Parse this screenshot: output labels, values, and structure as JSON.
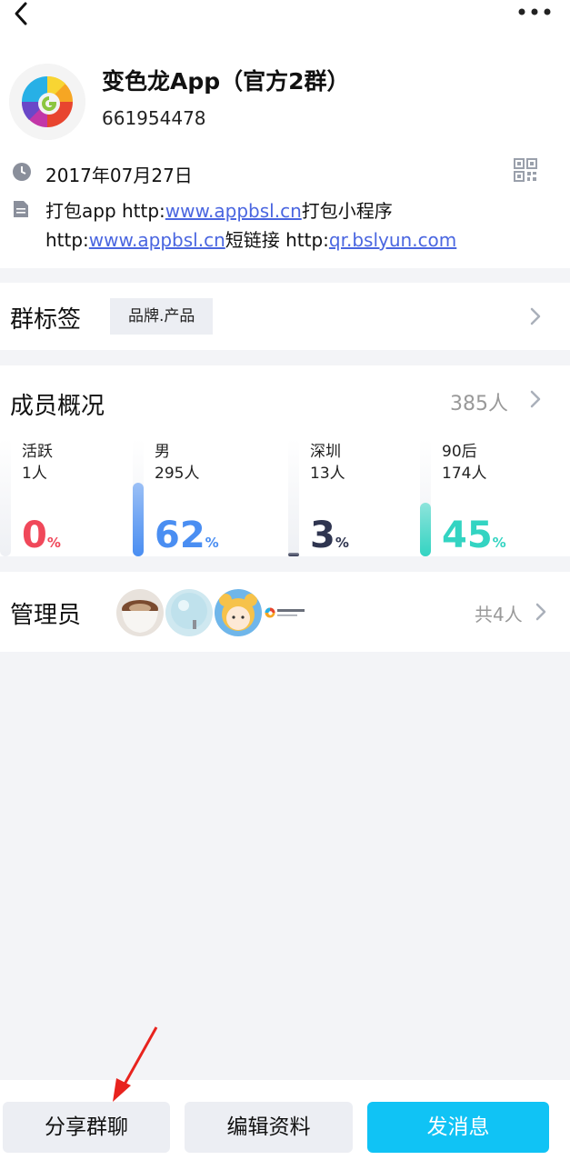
{
  "header": {
    "back_icon": "back-arrow-icon",
    "more_icon": "more-dots-icon"
  },
  "group": {
    "name": "变色龙App（官方2群）",
    "id": "661954478",
    "created_date": "2017年07月27日",
    "desc_line1_a": "打包app http:",
    "desc_link1": "www.appbsl.cn",
    "desc_line1_b": "打包小程序",
    "desc_line2_a": "http:",
    "desc_link2": "www.appbsl.cn",
    "desc_line2_b": "短链接 http:",
    "desc_link3": "qr.bslyun.com"
  },
  "tags": {
    "title": "群标签",
    "items": [
      "品牌.产品"
    ]
  },
  "members": {
    "title": "成员概况",
    "count": "385人",
    "stats": [
      {
        "label": "活跃",
        "value": "1人",
        "percent": "0",
        "unit": "%",
        "fraction": 0.0,
        "color": "#f0485a"
      },
      {
        "label": "男",
        "value": "295人",
        "percent": "62",
        "unit": "%",
        "fraction": 0.62,
        "color": "#4a8ef2"
      },
      {
        "label": "深圳",
        "value": "13人",
        "percent": "3",
        "unit": "%",
        "fraction": 0.03,
        "color": "#2f3550"
      },
      {
        "label": "90后",
        "value": "174人",
        "percent": "45",
        "unit": "%",
        "fraction": 0.45,
        "color": "#33d4c2"
      }
    ]
  },
  "admins": {
    "title": "管理员",
    "total": "共4人"
  },
  "actions": {
    "share": "分享群聊",
    "edit": "编辑资料",
    "message": "发消息"
  },
  "colors": {
    "link": "#4a66e0",
    "primary_button": "#10c3f5",
    "annotation_arrow": "#e8231e"
  }
}
